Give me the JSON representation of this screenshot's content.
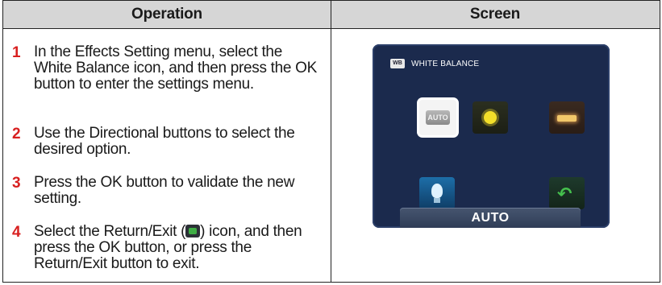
{
  "table": {
    "header_operation": "Operation",
    "header_screen": "Screen"
  },
  "steps": [
    {
      "number": "1",
      "text": "In the Effects Setting menu, select the White Balance icon, and then press the OK button to enter the settings menu."
    },
    {
      "number": "2",
      "text": "Use the Directional buttons to select the desired option."
    },
    {
      "number": "3",
      "text": "Press the OK button to validate the new setting."
    },
    {
      "number": "4",
      "text_before_icon": "Select the Return/Exit (",
      "icon": "return-exit-icon",
      "text_after_icon": ") icon, and then press the OK button, or press the Return/Exit button to exit."
    }
  ],
  "screen": {
    "badge": "WB",
    "title": "WHITE BALANCE",
    "auto_icon_text": "AUTO",
    "icons": [
      "auto-icon",
      "daylight-icon",
      "fluorescent-icon",
      "tungsten-icon",
      "return-icon"
    ],
    "selected_value": "AUTO"
  },
  "colors": {
    "step_number": "#d82020",
    "header_bg": "#d6d6d6",
    "screen_bg": "#1b2a4d"
  }
}
